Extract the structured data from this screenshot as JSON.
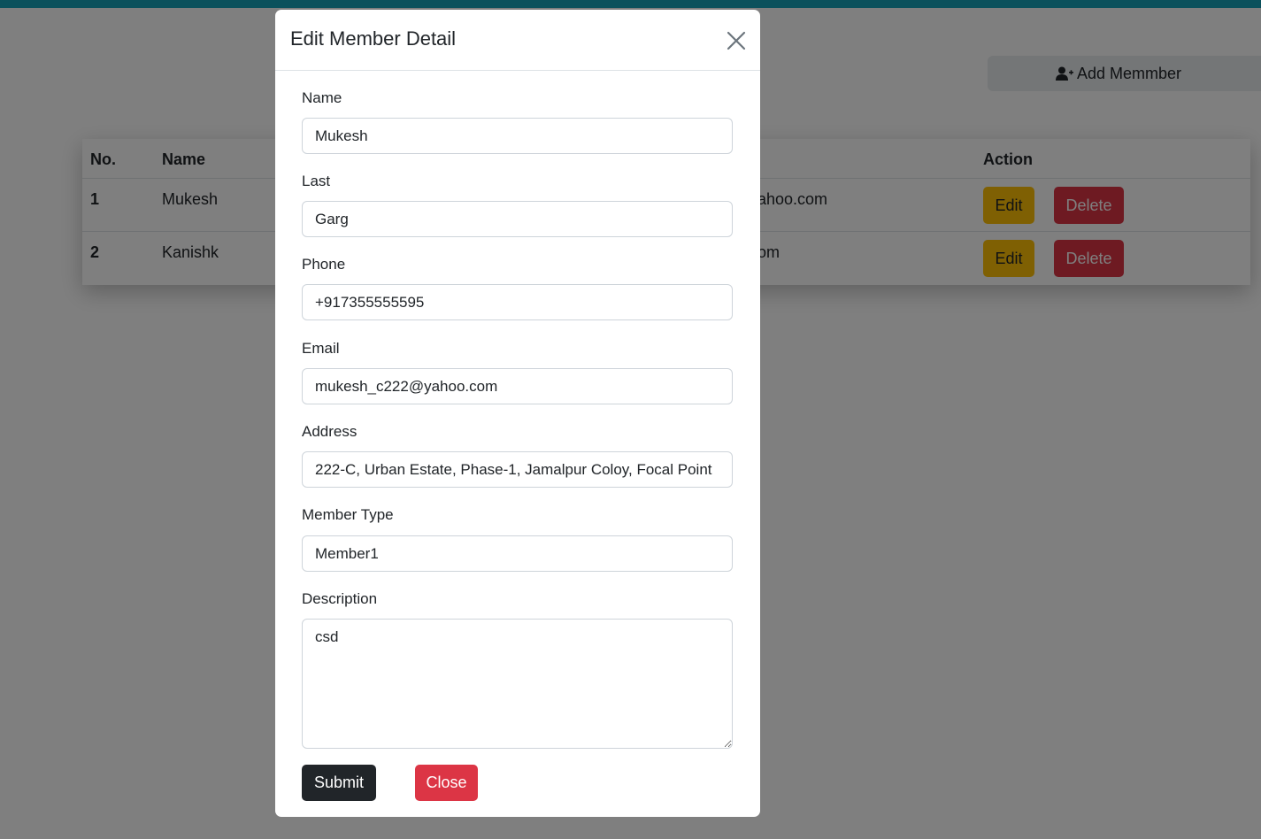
{
  "page": {
    "add_button_label": "Add Memmber"
  },
  "table": {
    "headers": {
      "no": "No.",
      "name": "Name",
      "action": "Action"
    },
    "rows": [
      {
        "no": "1",
        "name": "Mukesh",
        "email_partial": "ahoo.com",
        "edit": "Edit",
        "delete": "Delete"
      },
      {
        "no": "2",
        "name": "Kanishk",
        "email_partial": "om",
        "edit": "Edit",
        "delete": "Delete"
      }
    ]
  },
  "modal": {
    "title": "Edit Member Detail",
    "fields": {
      "name": {
        "label": "Name",
        "value": "Mukesh"
      },
      "last": {
        "label": "Last",
        "value": "Garg"
      },
      "phone": {
        "label": "Phone",
        "value": "+917355555595"
      },
      "email": {
        "label": "Email",
        "value": "mukesh_c222@yahoo.com"
      },
      "address": {
        "label": "Address",
        "value": "222-C, Urban Estate, Phase-1, Jamalpur Coloy, Focal Point"
      },
      "member_type": {
        "label": "Member Type",
        "value": "Member1"
      },
      "description": {
        "label": "Description",
        "value": "csd"
      }
    },
    "submit_label": "Submit",
    "close_label": "Close"
  },
  "colors": {
    "accent_topbar": "#17a2b8",
    "edit_button": "#ffc107",
    "delete_button": "#dc3545",
    "submit_button": "#212529",
    "close_button": "#dc3545"
  },
  "icons": {
    "add_member": "user-plus-icon",
    "modal_close": "close-icon"
  }
}
